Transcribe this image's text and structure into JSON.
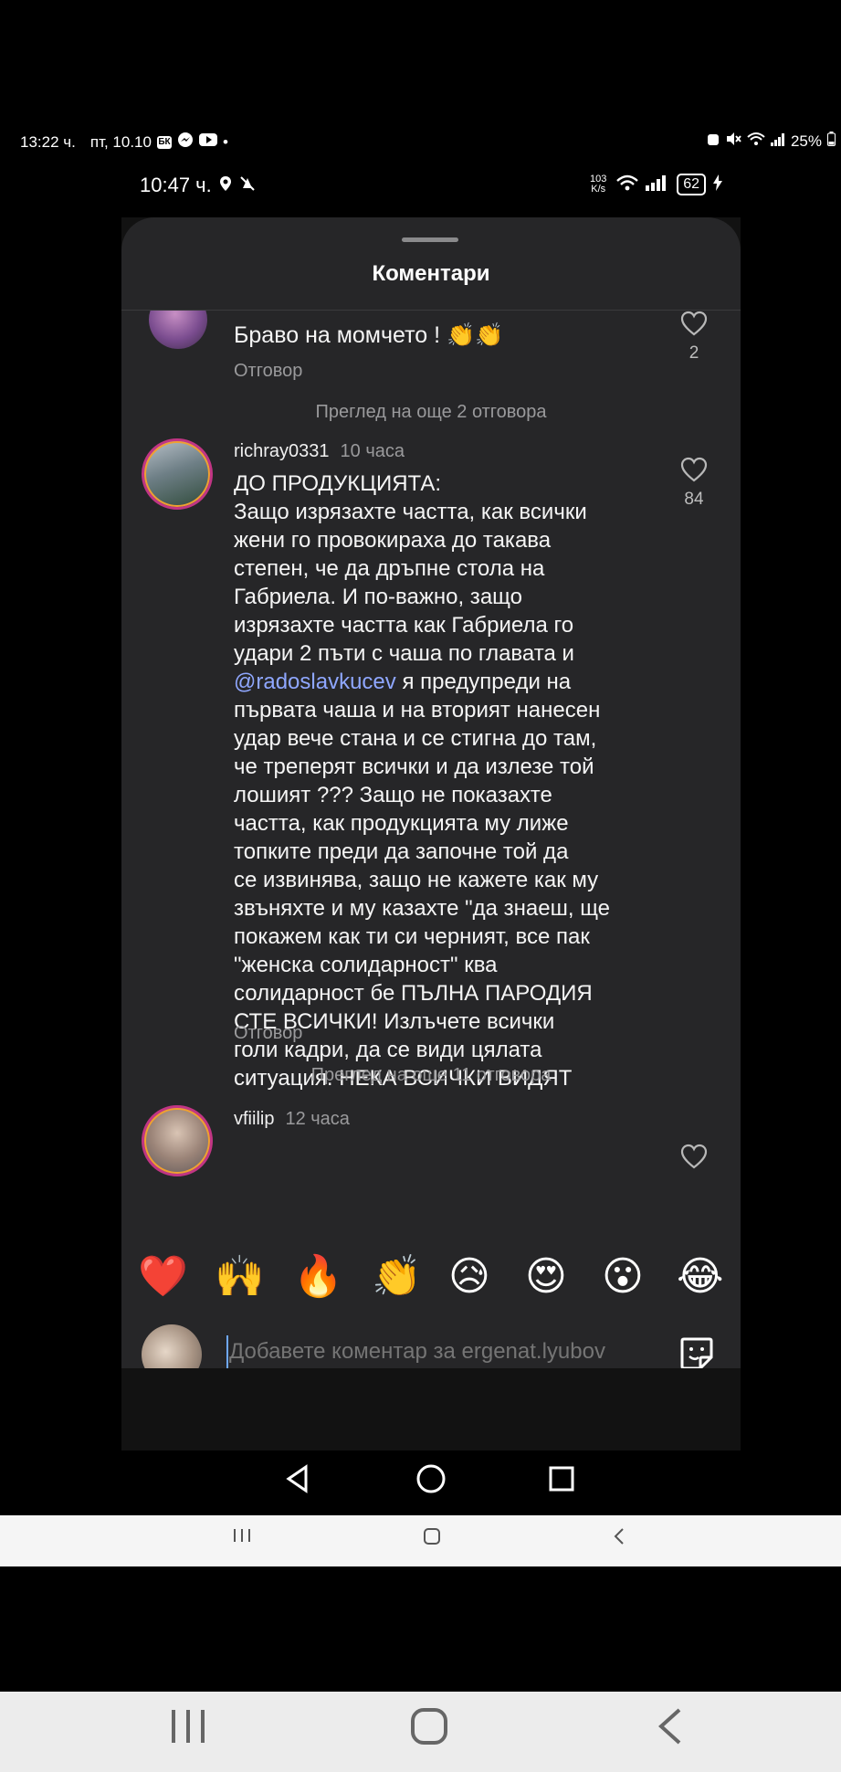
{
  "outer_status": {
    "time": "13:22 ч.",
    "date": "пт, 10.10",
    "battery": "25%"
  },
  "inner_status": {
    "time": "10:47 ч.",
    "net_speed": "103 K/s",
    "battery": "62"
  },
  "sheet": {
    "title": "Коментари"
  },
  "comments": [
    {
      "text": "Браво на момчето ! 👏👏",
      "reply_label": "Отговор",
      "likes": "2",
      "more_replies": "Преглед на още 2 отговора"
    },
    {
      "username": "richray0331",
      "time_ago": "10 часа",
      "text_before": "ДО ПРОДУКЦИЯТА:\nЗащо изрязахте частта, как всички\nжени го провокираха до такава\nстепен, че да дръпне стола на\nГабриела. И по-важно, защо\nизрязахте частта как Габриела го\nудари 2 пъти с чаша по главата и\n",
      "mention": "@radoslavkucev",
      "text_after": " я предупреди на\nпървата чаша и на вторият нанесен\nудар вече стана и се стигна до там,\nче треперят всички и да излезе той\nлошият ??? Защо не показахте\nчастта, как продукцията му лиже\nтопките преди да започне той да\nсе извинява, защо не кажете как му\nзвъняхте и му казахте \"да знаеш, ще\nпокажем как ти си черният, все пак\n\"женска солидарност\" ква\nсолидарност бе ПЪЛНА ПАРОДИЯ\nСТЕ ВСИЧКИ! Излъчете всички\nголи кадри, да се види цялата\nситуация. НЕКА ВСИЧКИ ВИДЯТ",
      "reply_label": "Отговор",
      "likes": "84",
      "more_replies": "Преглед на още 11 отговора"
    },
    {
      "username": "vfiilip",
      "time_ago": "12 часа"
    }
  ],
  "emoji_bar": [
    "❤️",
    "🙌",
    "🔥",
    "👏",
    "😥",
    "😍",
    "😮",
    "😂"
  ],
  "comment_input": {
    "placeholder": "Добавете коментар за ergenat.lyubov"
  },
  "icons": {
    "heart": "heart-outline-icon",
    "sticker": "sticker-icon",
    "back": "back-triangle-icon",
    "home": "home-circle-icon",
    "recents": "recents-square-icon"
  }
}
